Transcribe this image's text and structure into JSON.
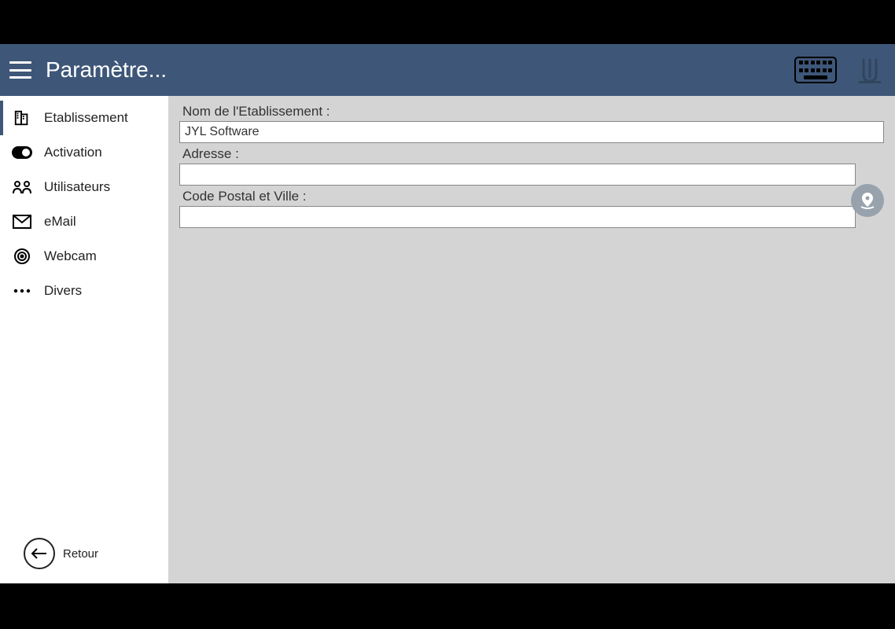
{
  "header": {
    "title": "Paramètre..."
  },
  "sidebar": {
    "items": [
      {
        "label": "Etablissement",
        "icon": "building-icon"
      },
      {
        "label": "Activation",
        "icon": "toggle-icon"
      },
      {
        "label": "Utilisateurs",
        "icon": "users-icon"
      },
      {
        "label": "eMail",
        "icon": "mail-icon"
      },
      {
        "label": "Webcam",
        "icon": "target-icon"
      },
      {
        "label": "Divers",
        "icon": "dots-icon"
      }
    ],
    "back_label": "Retour"
  },
  "form": {
    "establishment_label": "Nom de l'Etablissement :",
    "establishment_value": "JYL Software",
    "address_label": "Adresse :",
    "address_value": "",
    "postal_label": "Code Postal et Ville :",
    "postal_value": ""
  }
}
